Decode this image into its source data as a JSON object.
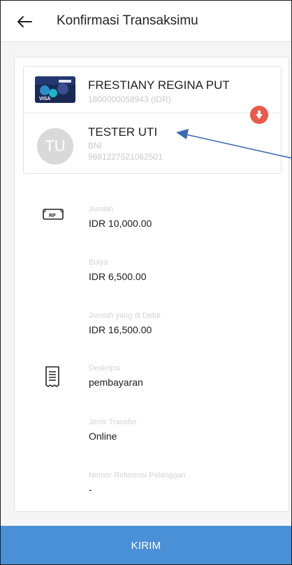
{
  "header": {
    "title": "Konfirmasi Transaksimu",
    "back_icon": "arrow-left-icon"
  },
  "source": {
    "name": "FRESTIANY REGINA PUT",
    "account": "1800000058943 (IDR)",
    "card_thumb_text": "VISA"
  },
  "destination": {
    "initials": "TU",
    "name": "TESTER UTI",
    "bank": "BNI",
    "account": "9881227521062501"
  },
  "direction_badge": {
    "icon": "arrow-down-icon",
    "color": "#ea5a4a"
  },
  "details": {
    "amount": {
      "label": "Jumlah",
      "value": "IDR 10,000.00",
      "icon": "money-note-icon"
    },
    "fee": {
      "label": "Biaya",
      "value": "IDR 6,500.00"
    },
    "debit_total": {
      "label": "Jumlah yang di Debit",
      "value": "IDR 16,500.00"
    },
    "description": {
      "label": "Deskripsi",
      "value": "pembayaran",
      "icon": "receipt-icon"
    },
    "transfer_type": {
      "label": "Jenis Transfer",
      "value": "Online"
    },
    "customer_ref": {
      "label": "Nomor Referensi Pelanggan",
      "value": "-"
    }
  },
  "submit": {
    "label": "KIRIM",
    "color": "#4a90d6"
  },
  "colors": {
    "annotation_arrow": "#3d6bb3"
  }
}
